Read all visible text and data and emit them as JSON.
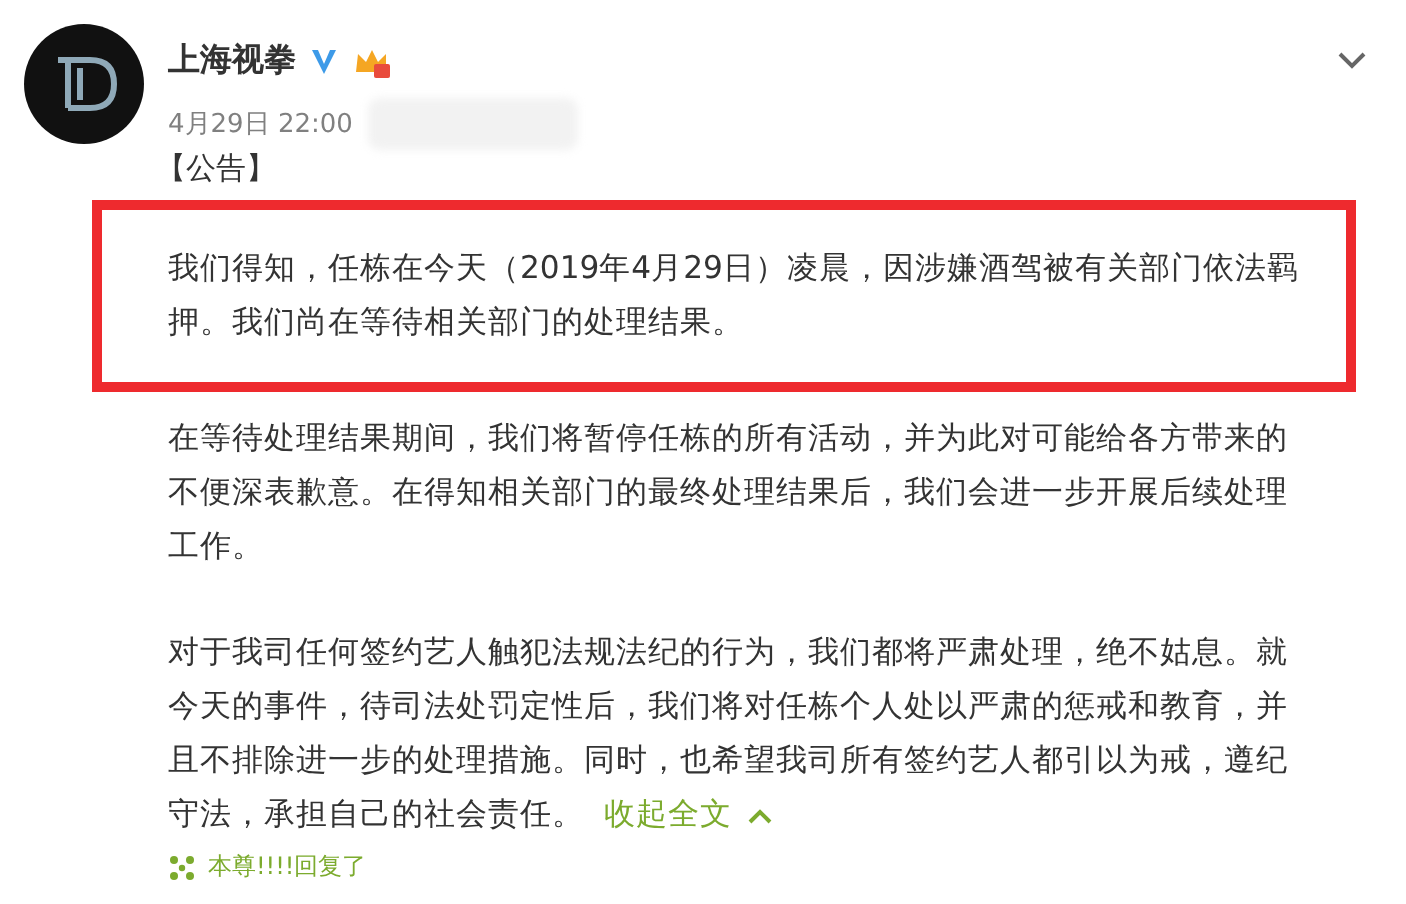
{
  "post": {
    "author": "上海视拳",
    "verified": true,
    "time": "4月29日 22:00",
    "tag": "【公告】",
    "highlighted_paragraph": "我们得知，任栋在今天（2019年4月29日）凌晨，因涉嫌酒驾被有关部门依法羁押。我们尚在等待相关部门的处理结果。",
    "paragraphs": [
      "在等待处理结果期间，我们将暂停任栋的所有活动，并为此对可能给各方带来的不便深表歉意。在得知相关部门的最终处理结果后，我们会进一步开展后续处理工作。",
      "对于我司任何签约艺人触犯法规法纪的行为，我们都将严肃处理，绝不姑息。就今天的事件，待司法处罚定性后，我们将对任栋个人处以严肃的惩戒和教育，并且不排除进一步的处理措施。同时，也希望我司所有签约艺人都引以为戒，遵纪守法，承担自己的社会责任。"
    ],
    "collapse_link": "收起全文",
    "reply_note": "本尊!!!!回复了"
  }
}
